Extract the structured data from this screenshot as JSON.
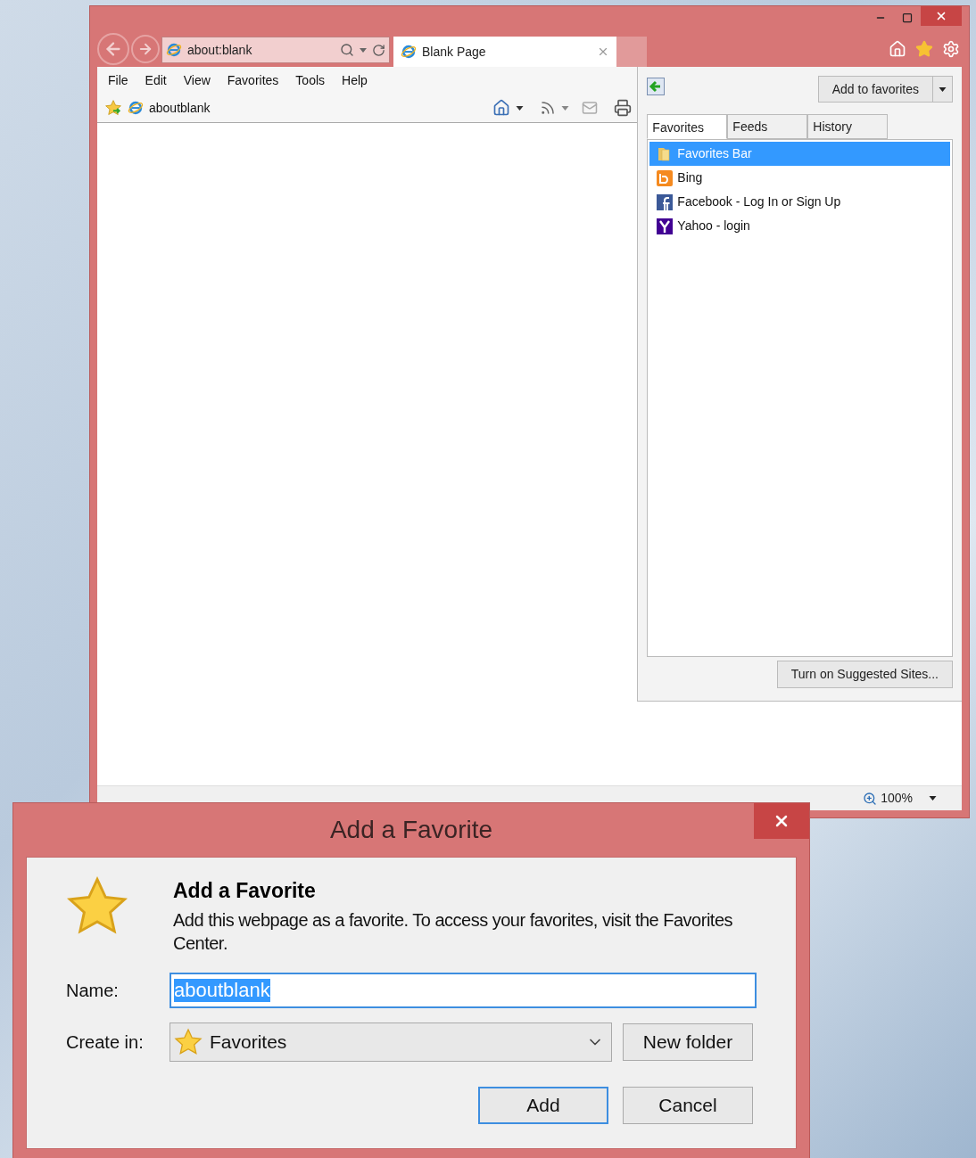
{
  "browser": {
    "address_bar": {
      "value": "about:blank"
    },
    "tabs": [
      {
        "label": "Blank Page",
        "selected": true
      }
    ],
    "menu": [
      "File",
      "Edit",
      "View",
      "Favorites",
      "Tools",
      "Help"
    ],
    "favorites_bar": [
      {
        "label": "aboutblank"
      }
    ],
    "favorites_center": {
      "add_button": "Add to favorites",
      "tabs": [
        {
          "label": "Favorites",
          "selected": true
        },
        {
          "label": "Feeds",
          "selected": false
        },
        {
          "label": "History",
          "selected": false
        }
      ],
      "items": [
        {
          "label": "Favorites Bar",
          "kind": "folder",
          "selected": true
        },
        {
          "label": "Bing",
          "kind": "bing",
          "selected": false
        },
        {
          "label": "Facebook - Log In or Sign Up",
          "kind": "facebook",
          "selected": false
        },
        {
          "label": "Yahoo - login",
          "kind": "yahoo",
          "selected": false
        }
      ],
      "suggested_button": "Turn on Suggested Sites..."
    },
    "status_bar": {
      "zoom": "100%"
    }
  },
  "dialog": {
    "title": "Add a Favorite",
    "heading": "Add a Favorite",
    "description": "Add this webpage as a favorite. To access your favorites, visit the Favorites Center.",
    "name_label": "Name:",
    "name_value": "aboutblank",
    "name_text_selected": true,
    "create_in_label": "Create in:",
    "create_in_value": "Favorites",
    "new_folder_button": "New folder",
    "buttons": [
      {
        "label": "Add",
        "default": true
      },
      {
        "label": "Cancel",
        "default": false
      }
    ]
  }
}
